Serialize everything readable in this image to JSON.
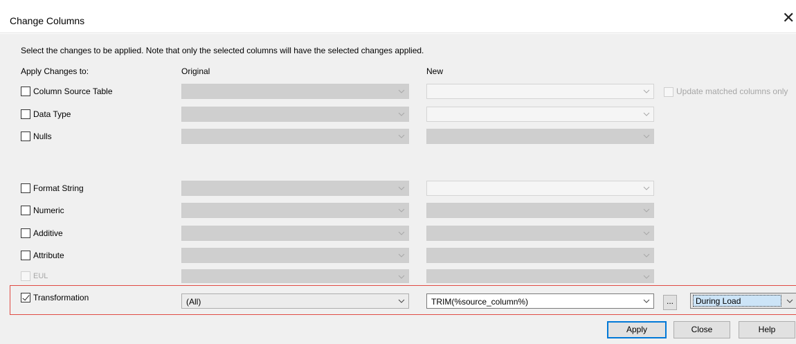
{
  "window": {
    "title": "Change Columns",
    "close_glyph": "✕"
  },
  "instructions": "Select the changes to be applied. Note that only the selected columns will have the selected changes applied.",
  "headers": {
    "apply_to": "Apply Changes to:",
    "original": "Original",
    "new": "New"
  },
  "rows": [
    {
      "label": "Column Source Table",
      "checked": false,
      "enabled": true,
      "original": "",
      "new": ""
    },
    {
      "label": "Data Type",
      "checked": false,
      "enabled": true,
      "original": "",
      "new": ""
    },
    {
      "label": "Nulls",
      "checked": false,
      "enabled": true,
      "original": "",
      "new": ""
    },
    {
      "label": "Format String",
      "checked": false,
      "enabled": true,
      "original": "",
      "new": ""
    },
    {
      "label": "Numeric",
      "checked": false,
      "enabled": true,
      "original": "",
      "new": ""
    },
    {
      "label": "Additive",
      "checked": false,
      "enabled": true,
      "original": "",
      "new": ""
    },
    {
      "label": "Attribute",
      "checked": false,
      "enabled": true,
      "original": "",
      "new": ""
    },
    {
      "label": "EUL",
      "checked": false,
      "enabled": false,
      "original": "",
      "new": ""
    },
    {
      "label": "Transformation",
      "checked": true,
      "enabled": true,
      "original": "(All)",
      "new": "TRIM(%source_column%)"
    }
  ],
  "update_matched": {
    "label": "Update matched columns only",
    "checked": false,
    "enabled": false
  },
  "ellipsis_button": "...",
  "load_timing": {
    "selected": "During Load"
  },
  "buttons": {
    "apply": "Apply",
    "close": "Close",
    "help": "Help"
  },
  "colors": {
    "highlight": "#e04a43",
    "default_button_border": "#0078d7"
  }
}
